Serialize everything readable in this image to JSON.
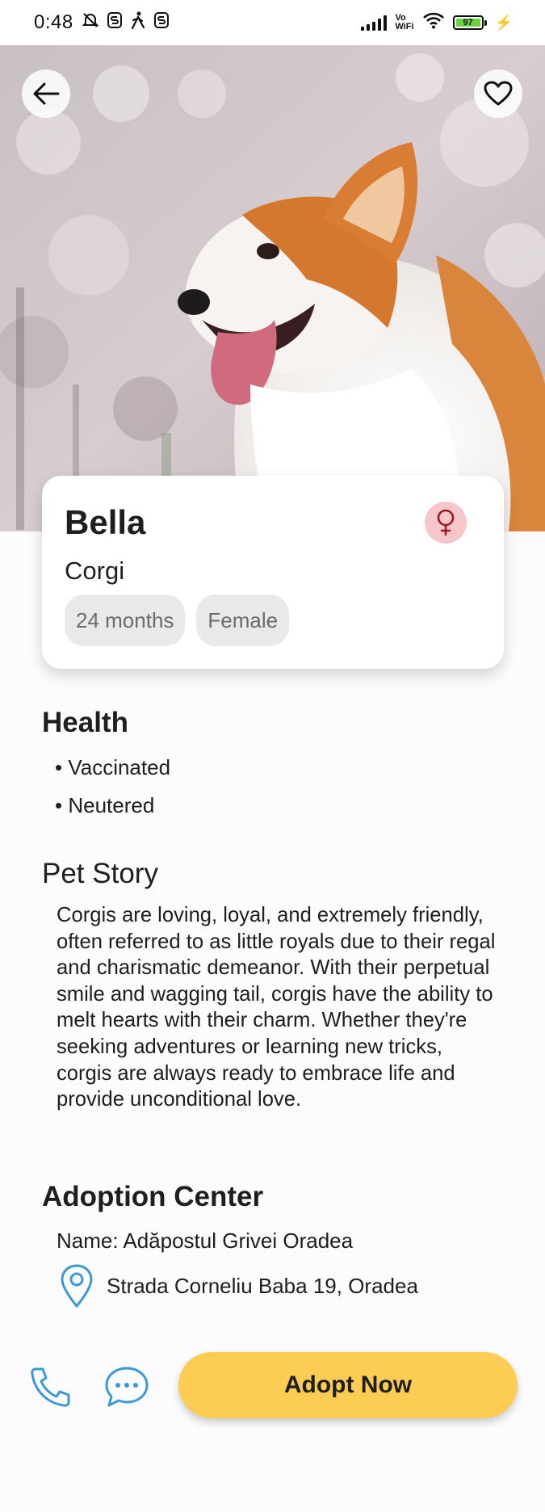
{
  "status_bar": {
    "time": "0:48",
    "icons": [
      "silent-bell-icon",
      "notification-s-icon",
      "walking-icon",
      "notification-s-icon"
    ],
    "vowifi_top": "Vo",
    "vowifi_bottom": "WiFi",
    "battery": "97",
    "charging_symbol": "⚡"
  },
  "pet": {
    "name": "Bella",
    "breed": "Corgi",
    "age": "24 months",
    "sex": "Female",
    "gender_symbol": "♀",
    "photo_subject": "Corgi dog"
  },
  "health": {
    "title": "Health",
    "items": [
      "• Vaccinated",
      "• Neutered"
    ]
  },
  "story": {
    "title": "Pet Story",
    "text": "Corgis are loving, loyal, and extremely friendly, often referred to as little royals due to their regal and charismatic demeanor. With their perpetual smile and wagging tail, corgis have the ability to melt hearts with their charm. Whether they're seeking adventures or learning new tricks, corgis are always ready to embrace life and provide unconditional love."
  },
  "adoption_center": {
    "title": "Adoption Center",
    "name_line": "Name: Adăpostul Grivei Oradea",
    "address": "Strada Corneliu Baba 19, Oradea"
  },
  "actions": {
    "adopt_label": "Adopt Now"
  },
  "colors": {
    "accent_blue": "#3a9ad9",
    "adopt_yellow": "#fccd52",
    "gender_bg": "#f6c6cb",
    "gender_fg": "#9b1b26",
    "chip_bg": "#e9e9ea"
  }
}
